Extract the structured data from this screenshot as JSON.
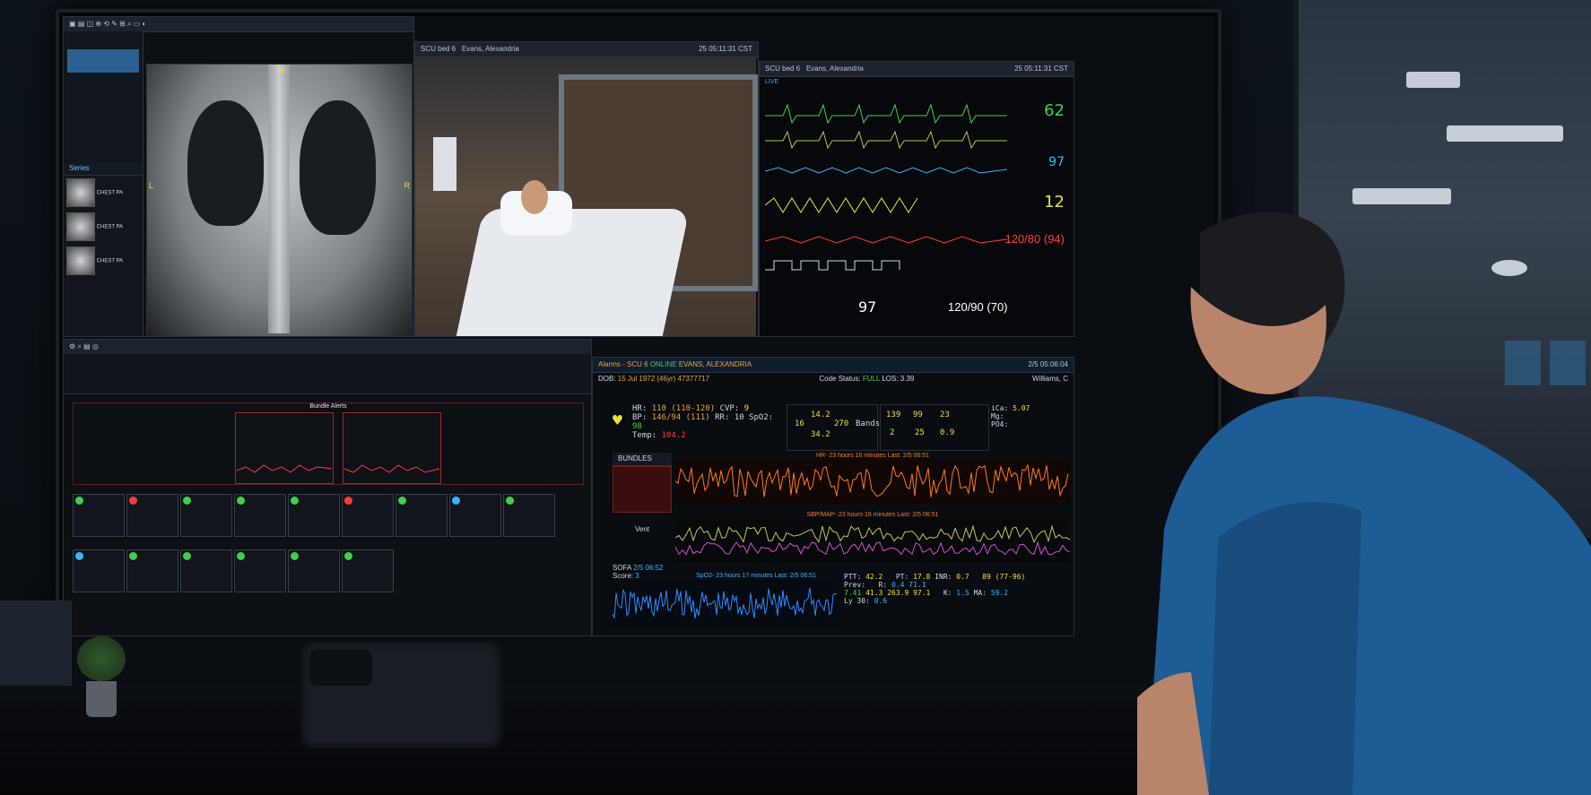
{
  "xray_viewer": {
    "series_label": "Series",
    "thumb_labels": [
      "CHEST PA",
      "CHEST PA",
      "CHEST PA"
    ],
    "marker_h": "H",
    "marker_l": "L",
    "marker_r": "R"
  },
  "video": {
    "title": "SCU bed 6",
    "patient": "Evans, Alexandria",
    "timestamp": "25 05:11:31 CST"
  },
  "monitor": {
    "title": "SCU bed 6",
    "patient": "Evans, Alexandria",
    "timestamp": "25 05:11:31 CST",
    "live_label": "LIVE",
    "hr": "62",
    "spo2": "97",
    "rr": "12",
    "abp": "120/80",
    "abp_map": "(94)",
    "temp": "97",
    "nibp": "120/90",
    "nibp_map": "(70)"
  },
  "bundle_panel": {
    "title": "Bundle Alerts"
  },
  "detail": {
    "alarm_title": "Alarms - SCU 6",
    "online": "ONLINE",
    "patient": "EVANS, ALEXANDRIA",
    "dob_label": "DOB:",
    "dob": "15 Jul 1972 (46yr)",
    "mrn": "47377717",
    "code_status_label": "Code Status:",
    "code_status": "FULL",
    "los_label": "LOS:",
    "los": "3.39",
    "date": "2/5 05:06:04",
    "attending": "Williams, C",
    "hr_label": "HR:",
    "hr": "110 (110-120)",
    "cvp_label": "CVP:",
    "cvp": "9",
    "bp_label": "BP:",
    "bp": "146/94 (111)",
    "rr_label": "RR:",
    "rr": "10",
    "spo2_label": "SpO2:",
    "spo2": "98",
    "temp_label": "Temp:",
    "temp": "104.2",
    "heme_a": "14.2",
    "heme_b": "16",
    "heme_c": "270",
    "heme_d": "34.2",
    "bands_label": "Bands",
    "chem": [
      "139",
      "99",
      "23",
      "2",
      "25",
      "0.9"
    ],
    "ica_label": "iCa:",
    "ica": "5.07",
    "mg_label": "Mg:",
    "po4_label": "PO4:",
    "bundles_label": "BUNDLES",
    "vent_label": "Vent",
    "sofa_label": "SOFA",
    "sofa_date": "2/5 06:52",
    "sofa_score_label": "Score:",
    "sofa_score": "3",
    "hr_trend": "HR- 23 hours 16 minutes Last: 2/5 06:51",
    "sbp_trend": "SBP/MAP- 23 hours 16 minutes Last: 2/5 06:51",
    "spo2_trend": "SpO2- 23 hours 17 minutes Last: 2/5 06:51",
    "ptt_label": "PTT:",
    "ptt": "42.2",
    "pt_label": "PT:",
    "pt": "17.8",
    "inr_label": "INR:",
    "inr": "0.7",
    "lactate_label": "Prev:",
    "blood_gas": [
      "7.41",
      "41.3",
      "263.9",
      "97.1"
    ],
    "glucose": "89 (77-96)",
    "teg_r_label": "R:",
    "teg_r": "0.4",
    "teg_k_label": "K:",
    "teg_k": "1.5",
    "teg_ma_label": "MA:",
    "teg_ma": "59.2",
    "teg_ly_label": "Ly 30:",
    "teg_ly": "0.6",
    "teg_a": "71.1"
  },
  "colors": {
    "green": "#3fd14a",
    "yellow": "#e8e23a",
    "cyan": "#38b6ff",
    "red": "#ff3a3a",
    "orange": "#ff7a1a",
    "magenta": "#d24bd6"
  }
}
